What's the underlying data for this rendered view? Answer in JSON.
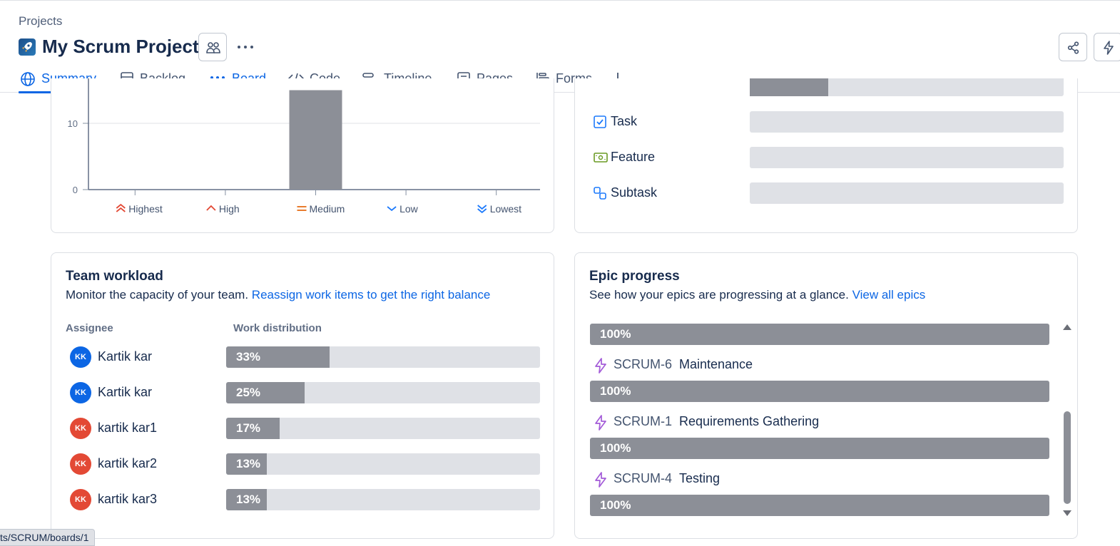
{
  "breadcrumb": "Projects",
  "project": {
    "title": "My Scrum Project"
  },
  "tabs": [
    {
      "label": "Summary",
      "active": true,
      "icon": "globe-icon"
    },
    {
      "label": "Backlog",
      "icon": "backlog-icon"
    },
    {
      "label": "Board",
      "active": true,
      "icon": "board-icon"
    },
    {
      "label": "Code",
      "icon": "code-icon"
    },
    {
      "label": "Timeline",
      "icon": "timeline-icon"
    },
    {
      "label": "Pages",
      "icon": "pages-icon"
    },
    {
      "label": "Forms",
      "icon": "forms-icon"
    }
  ],
  "chart_data": {
    "type": "bar",
    "categories": [
      "Highest",
      "High",
      "Medium",
      "Low",
      "Lowest"
    ],
    "values": [
      0,
      0,
      15,
      0,
      0
    ],
    "y_ticks": [
      "0",
      "10"
    ],
    "ylim": [
      0,
      15
    ],
    "grid": true,
    "category_colors": [
      "#e34935",
      "#e34935",
      "#e56910",
      "#1d7afc",
      "#1d7afc"
    ]
  },
  "types": [
    {
      "name": "Task",
      "icon": "task-icon"
    },
    {
      "name": "Feature",
      "icon": "feature-icon"
    },
    {
      "name": "Subtask",
      "icon": "subtask-icon"
    }
  ],
  "types_partial_fill": 0.25,
  "workload": {
    "title": "Team workload",
    "subtitle": "Monitor the capacity of your team.",
    "link": "Reassign work items to get the right balance",
    "col_assignee": "Assignee",
    "col_distribution": "Work distribution",
    "rows": [
      {
        "initials": "KK",
        "name": "Kartik kar",
        "pct": "33%",
        "value": 0.33,
        "color": "#0c66e4"
      },
      {
        "initials": "KK",
        "name": "Kartik kar",
        "pct": "25%",
        "value": 0.25,
        "color": "#0c66e4"
      },
      {
        "initials": "KK",
        "name": "kartik kar1",
        "pct": "17%",
        "value": 0.17,
        "color": "#e34935"
      },
      {
        "initials": "KK",
        "name": "kartik kar2",
        "pct": "13%",
        "value": 0.13,
        "color": "#e34935"
      },
      {
        "initials": "KK",
        "name": "kartik kar3",
        "pct": "13%",
        "value": 0.13,
        "color": "#e34935"
      }
    ]
  },
  "epics": {
    "title": "Epic progress",
    "subtitle": "See how your epics are progressing at a glance.",
    "link": "View all epics",
    "first_pct": "100%",
    "items": [
      {
        "key": "SCRUM-6",
        "name": "Maintenance",
        "pct": "100%"
      },
      {
        "key": "SCRUM-1",
        "name": "Requirements Gathering",
        "pct": "100%"
      },
      {
        "key": "SCRUM-4",
        "name": "Testing",
        "pct": "100%"
      }
    ]
  },
  "status_url": "ts/SCRUM/boards/1"
}
